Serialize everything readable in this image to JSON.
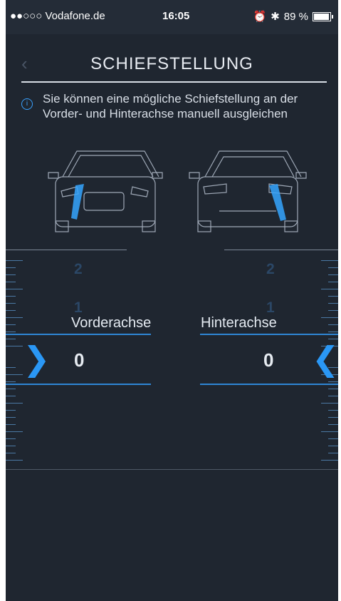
{
  "statusbar": {
    "carrier": "●●○○○ Vodafone.de",
    "time": "16:05",
    "battery_text": "89 %",
    "battery_level": 0.89
  },
  "header": {
    "title": "SCHIEFSTELLUNG",
    "back_icon": "chevron-left-icon"
  },
  "info": {
    "icon": "info-icon",
    "text": "Sie können eine mögliche Schiefstellung an der Vorder- und Hinterachse manuell ausgleichen"
  },
  "front": {
    "scale_labels": [
      "2",
      "1"
    ],
    "label": "Vorderachse",
    "value": "0",
    "adjust_icon": "chevron-right-icon"
  },
  "rear": {
    "scale_labels": [
      "2",
      "1"
    ],
    "label": "Hinterachse",
    "value": "0",
    "adjust_icon": "chevron-left-icon"
  },
  "colors": {
    "background": "#1f2630",
    "accent": "#2a97f5",
    "text": "#e6ebf1"
  }
}
